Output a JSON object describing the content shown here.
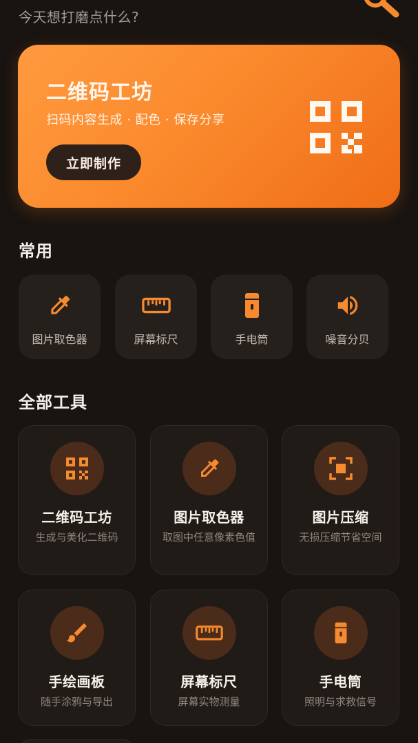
{
  "header": {
    "subtitle": "今天想打磨点什么?",
    "search_icon": "search-icon"
  },
  "hero": {
    "title": "二维码工坊",
    "description": "扫码内容生成 · 配色 · 保存分享",
    "button_label": "立即制作",
    "icon": "qr-code-icon",
    "gradient": [
      "#ff9a3f",
      "#ef6d17"
    ]
  },
  "common": {
    "title": "常用",
    "items": [
      {
        "label": "图片取色器",
        "icon": "eyedropper-icon"
      },
      {
        "label": "屏幕标尺",
        "icon": "ruler-icon"
      },
      {
        "label": "手电筒",
        "icon": "flashlight-icon"
      },
      {
        "label": "噪音分贝",
        "icon": "speaker-icon"
      }
    ]
  },
  "all_tools": {
    "title": "全部工具",
    "items": [
      {
        "title": "二维码工坊",
        "desc": "生成与美化二维码",
        "icon": "qr-code-icon"
      },
      {
        "title": "图片取色器",
        "desc": "取图中任意像素色值",
        "icon": "eyedropper-icon"
      },
      {
        "title": "图片压缩",
        "desc": "无损压缩节省空间",
        "icon": "compress-icon"
      },
      {
        "title": "手绘画板",
        "desc": "随手涂鸦与导出",
        "icon": "brush-icon"
      },
      {
        "title": "屏幕标尺",
        "desc": "屏幕实物测量",
        "icon": "ruler-icon"
      },
      {
        "title": "手电筒",
        "desc": "照明与求救信号",
        "icon": "flashlight-icon"
      }
    ]
  },
  "colors": {
    "accent": "#f58a2e",
    "background": "#181411",
    "card": "#211b17",
    "icon_circle": "#4b2b1a"
  }
}
